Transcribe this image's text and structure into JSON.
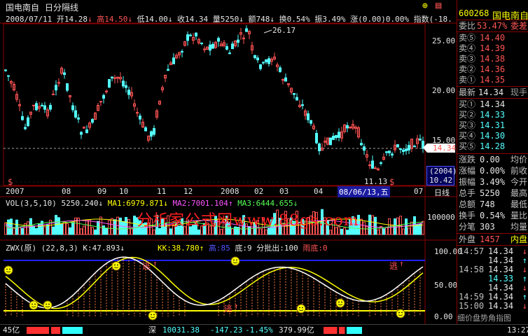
{
  "header": {
    "stock_name": "国电南自",
    "period": "日分隔线",
    "icons": [
      "add-icon",
      "chart-icon"
    ]
  },
  "quote_line": {
    "date": "2008/07/11",
    "open": "开14.28",
    "high": "高14.50",
    "low": "低14.00",
    "close": "收14.34",
    "volume": "量5250",
    "amount": "额748",
    "turnover": "换0.54%",
    "amplitude": "振3.49%",
    "change": "涨(0.00)0.00%",
    "index": "指数(-18."
  },
  "price_axis": {
    "ticks": [
      "25.00",
      "20.00",
      "15.00"
    ],
    "current_price": "14.34",
    "peak_label": "26.17",
    "trough_label": "11.13",
    "extra_low": "10.42",
    "extra_year": "(2004)"
  },
  "x_axis": {
    "labels": [
      "2007",
      "08",
      "09",
      "10",
      "11",
      "12",
      "2008",
      "02",
      "03",
      "04",
      "07"
    ],
    "cursor_label": "08/06/13,五",
    "mode": "日线"
  },
  "volume_panel": {
    "title": "VOL(3,5,10)",
    "vol": "5250.240",
    "ma1": "MA1:6979.871",
    "ma2": "MA2:7001.104",
    "ma3": "MA3:6444.655",
    "tick": "100000"
  },
  "watermark": "分析家公式网www.88gs.com",
  "indicator_panel": {
    "name": "ZWX(原)",
    "params": "(22,8,3)",
    "k": "K:47.893",
    "kk": "KK:38.780",
    "high": "高:85",
    "bottom": "底:9",
    "sell": "分批出:100",
    "rain": "雨底:0",
    "ticks": [
      "100.00",
      "50.00",
      "0.00"
    ],
    "signals": [
      "逃",
      "逃",
      "逃"
    ]
  },
  "right_panel": {
    "code": "600268",
    "name": "国电南自",
    "wei_bi_label": "委比",
    "wei_bi": "53.47%",
    "wei_cha_label": "委差",
    "sells": [
      {
        "label": "卖⑤",
        "price": "14.40"
      },
      {
        "label": "卖④",
        "price": "14.39"
      },
      {
        "label": "卖③",
        "price": "14.38"
      },
      {
        "label": "卖②",
        "price": "14.36"
      },
      {
        "label": "卖①",
        "price": "14.35"
      }
    ],
    "latest_label": "最新",
    "latest": "14.34",
    "spot_label": "现手",
    "buys": [
      {
        "label": "买①",
        "price": "14.34"
      },
      {
        "label": "买②",
        "price": "14.33"
      },
      {
        "label": "买③",
        "price": "14.31"
      },
      {
        "label": "买④",
        "price": "14.30"
      },
      {
        "label": "买⑤",
        "price": "14.28"
      }
    ],
    "stats": [
      {
        "label": "涨跌",
        "val": "0.00",
        "right": "均价"
      },
      {
        "label": "涨幅",
        "val": "0.00%",
        "right": "前收"
      },
      {
        "label": "振幅",
        "val": "3.49%",
        "right": "今开"
      },
      {
        "label": "总手",
        "val": "5250",
        "right": "最高"
      },
      {
        "label": "总额",
        "val": "748",
        "right": "最低"
      },
      {
        "label": "换手",
        "val": "0.54%",
        "right": "量比"
      },
      {
        "label": "分笔",
        "val": "303",
        "right": "均量"
      }
    ],
    "outer_label": "外盘",
    "outer": "1457",
    "inner_label": "内盘",
    "ticks": [
      {
        "time": "14:57",
        "price": "14.34"
      },
      {
        "time": "",
        "price": "14.34"
      },
      {
        "time": "14:58",
        "price": "14.34"
      },
      {
        "time": "",
        "price": "14.33"
      },
      {
        "time": "",
        "price": "14.34"
      },
      {
        "time": "14:59",
        "price": "14.34"
      },
      {
        "time": "15:00",
        "price": "14.34"
      }
    ],
    "footer": "细价盘势角指图"
  },
  "status_bar": {
    "left": "45亿",
    "market": "深",
    "index": "10031.38",
    "change": "-147.23",
    "pct": "-1.45%",
    "amount": "379.99亿",
    "time": "13:27"
  },
  "colors": {
    "up": "#ff5454",
    "down": "#54ffff",
    "yellow": "#ffff00",
    "blue_line": "#2020ff",
    "white": "#ffffff"
  }
}
